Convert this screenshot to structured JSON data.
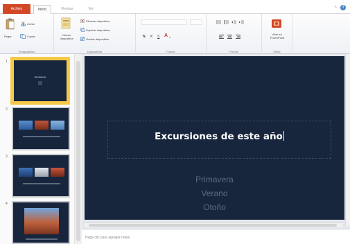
{
  "tabs": {
    "file": "Archivo",
    "home": "Inicio",
    "review": "Revisar",
    "view": "Ver"
  },
  "help_icon_glyph": "?",
  "minimize_glyph": "˄",
  "ribbon": {
    "clipboard": {
      "label": "Portapapeles",
      "paste": "Pegar",
      "cut": "Cortar",
      "copy": "Copiar"
    },
    "slides": {
      "label": "Diapositivas",
      "new_slide": "Nueva\ndiapositiva",
      "delete_slide": "Eliminar diapositiva",
      "duplicate_slide": "Duplicar diapositiva",
      "hide_slide": "Ocultar diapositiva"
    },
    "font": {
      "label": "Fuente",
      "bold": "N",
      "italic": "K",
      "underline": "S",
      "font_color": "A"
    },
    "paragraph": {
      "label": "Párrafo"
    },
    "office": {
      "label": "Office",
      "open_in_powerpoint": "Abrir en\nPowerPoint"
    }
  },
  "thumbnails": [
    {
      "number": "1",
      "title": "Excursiones",
      "selected": true
    },
    {
      "number": "2",
      "selected": false
    },
    {
      "number": "3",
      "selected": false
    },
    {
      "number": "4",
      "selected": false
    }
  ],
  "slide": {
    "title": "Excursiones de este año",
    "subtitles": [
      "Primavera",
      "Verano",
      "Otoño"
    ]
  },
  "notes_placeholder": "Haga clic para agregar notas",
  "colors": {
    "file_tab": "#d24726",
    "slide_background": "#18263d",
    "selected_thumb_border": "#f7c948",
    "subtitle_text": "#5d6a7e"
  }
}
